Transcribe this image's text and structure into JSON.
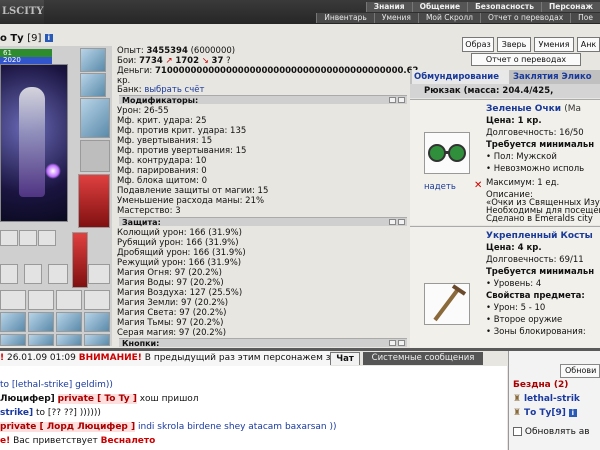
{
  "header": {
    "logo": "LSCITY",
    "nav_primary": [
      "Знания",
      "Общение",
      "Безопасность",
      "Персонаж"
    ],
    "nav_secondary": [
      "Инвентарь",
      "Умения",
      "Мой Скролл",
      "Отчет о переводах",
      "Пое"
    ]
  },
  "character": {
    "name": "о Ту",
    "level": "[9]",
    "info_icon": "i",
    "hp": "61",
    "mana": "2020"
  },
  "stats": {
    "experience_label": "Опыт:",
    "experience_value": "3455394",
    "experience_next": "(6000000)",
    "battles_label": "Бои:",
    "battles_wins": "7734",
    "battles_losses": "1702",
    "battles_draws": "37",
    "money_label": "Деньги:",
    "money_value": "710000000000000000000000000000000000000000.62",
    "money_unit": "кр.",
    "bank_label": "Банк:",
    "bank_link": "выбрать счёт"
  },
  "modifiers": {
    "title": "Модификаторы:",
    "lines": [
      "Урон: 26-55",
      "Мф. крит. удара: 25",
      "Мф. против крит. удара: 135",
      "Мф. увертывания: 15",
      "Мф. против увертывания: 15",
      "Мф. контрудара: 10",
      "Мф. парирования: 0",
      "Мф. блока щитом: 0",
      "Подавление защиты от магии: 15",
      "Уменьшение расхода маны: 21%",
      "Мастерство: 3"
    ]
  },
  "protection": {
    "title": "Защита:",
    "lines": [
      "Колющий урон: 166 (31.9%)",
      "Рубящий урон: 166 (31.9%)",
      "Дробящий урон: 166 (31.9%)",
      "Режущий урон: 166 (31.9%)",
      "Магия Огня: 97 (20.2%)",
      "Магия Воды: 97 (20.2%)",
      "Магия Воздуха: 127 (25.5%)",
      "Магия Земли: 97 (20.2%)",
      "Магия Света: 97 (20.2%)",
      "Магия Тьмы: 97 (20.2%)",
      "Серая магия: 97 (20.2%)"
    ]
  },
  "buttons_section": {
    "title": "Кнопки:"
  },
  "right_panel": {
    "tabs": [
      "Образ",
      "Зверь",
      "Умения",
      "Анк"
    ],
    "report_button": "Отчет о переводах",
    "subtabs": [
      "Обмундирование",
      "Заклятия",
      "Элико"
    ],
    "backpack": "Рюкзак (масса: 204.4/425,",
    "items": [
      {
        "name": "Зеленые Очки",
        "name_suffix": "(Ма",
        "price": "Цена: 1 кр.",
        "durability": "Долговечность: 16/50",
        "requirements": "Требуется минимальн",
        "req1": "• Пол: Мужской",
        "req2": "• Невозможно исполь",
        "max": "Максимум: 1 ед.",
        "desc_label": "Описание:",
        "desc1": "«Очки из Священных Изум",
        "desc2": "Необходимы для посещени",
        "desc3": "Сделано в Emeralds city",
        "wear": "надеть"
      },
      {
        "name": "Укрепленный Косты",
        "price": "Цена: 4 кр.",
        "durability": "Долговечность: 69/11",
        "requirements": "Требуется минимальн",
        "req1": "• Уровень: 4",
        "props": "Свойства предмета:",
        "prop1": "• Урон: 5 - 10",
        "prop2": "• Второе оружие",
        "prop3": "• Зоны блокирования:"
      }
    ]
  },
  "chat": {
    "tabs": [
      "Чат",
      "Системные сообщения"
    ],
    "system_time": "26.01.09 01:09",
    "system_alert": "ВНИМАНИЕ!",
    "system_text": "В предыдущий раз этим персонажем заходили с другого",
    "lines": [
      {
        "p1": "to [lethal-strike] geldim))"
      },
      {
        "p1": "Люцифер]",
        "pv": "private [ To Ty ]",
        "p2": "хош пришол"
      },
      {
        "p1": "strike]",
        "p2": "to [?? ??] ))))))"
      },
      {
        "pv": "private [ Лорд Люцифер ]",
        "p2": "indi skrola birdene shey atacam baxarsan ))"
      },
      {
        "rd": "е!",
        "p1": "Вас приветствует",
        "rd2": "Весналето"
      }
    ]
  },
  "online": {
    "refresh": "Обнови",
    "location": "Бездна (2)",
    "users": [
      "lethal-strik",
      "То Ту[9]"
    ],
    "auto_refresh": "Обновлять ав"
  }
}
